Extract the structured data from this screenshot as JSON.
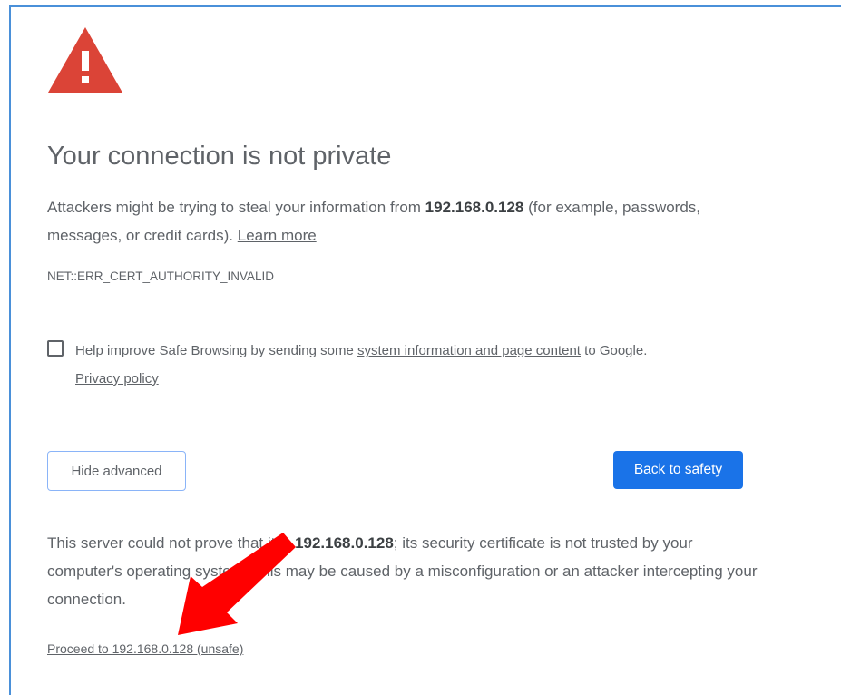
{
  "title": "Your connection is not private",
  "intro": {
    "before": "Attackers might be trying to steal your information from ",
    "host": "192.168.0.128",
    "after": " (for example, passwords, messages, or credit cards). ",
    "learn_more": "Learn more"
  },
  "error_code": "NET::ERR_CERT_AUTHORITY_INVALID",
  "safe_browsing": {
    "before": "Help improve Safe Browsing by sending some ",
    "link": "system information and page content",
    "after": " to Google.",
    "privacy": "Privacy policy",
    "checked": false
  },
  "buttons": {
    "hide_advanced": "Hide advanced",
    "back_to_safety": "Back to safety"
  },
  "details": {
    "before": "This server could not prove that it is ",
    "host": "192.168.0.128",
    "after": "; its security certificate is not trusted by your computer's operating system. This may be caused by a misconfiguration or an attacker intercepting your connection."
  },
  "proceed_link": "Proceed to 192.168.0.128 (unsafe)",
  "colors": {
    "warning_red": "#db4437",
    "primary_blue": "#1a73e8",
    "annotation_arrow": "#ff0000"
  },
  "icons": {
    "warning": "warning-triangle-icon",
    "annotation": "red-arrow-annotation"
  }
}
